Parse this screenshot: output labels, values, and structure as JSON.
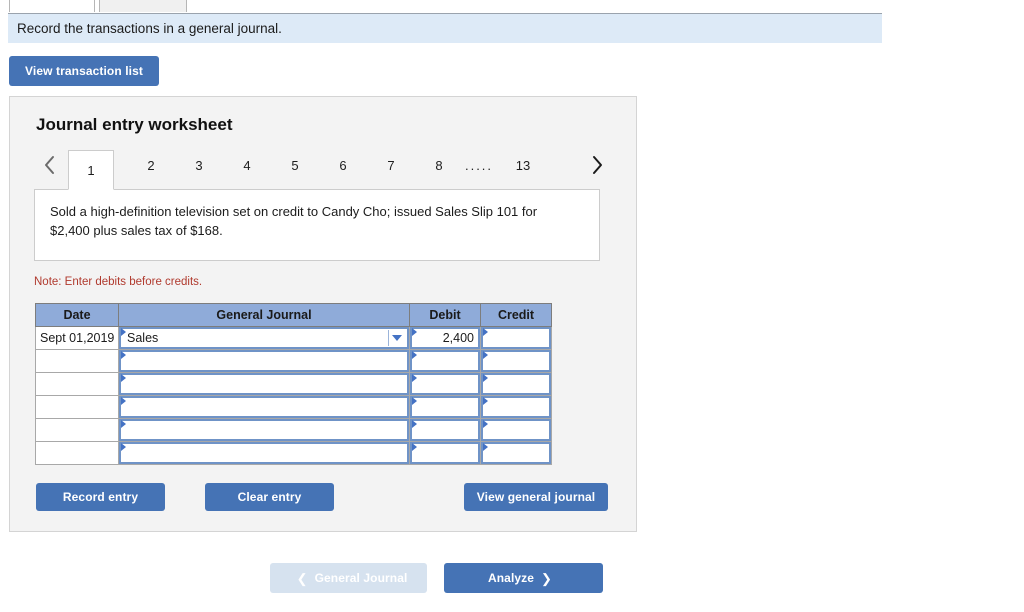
{
  "top_tabs": [
    {
      "name": "tab-one",
      "label": "",
      "active": true
    },
    {
      "name": "tab-two",
      "label": "",
      "active": false
    }
  ],
  "banner": {
    "text": "Record the transactions in a general journal.",
    "background": "#ddeaf7"
  },
  "toolbar": {
    "view_transaction_list_label": "View transaction list"
  },
  "worksheet": {
    "title": "Journal entry worksheet",
    "pager": {
      "prev_icon": "chevron-left-icon",
      "next_icon": "chevron-right-icon",
      "pages": [
        "1",
        "2",
        "3",
        "4",
        "5",
        "6",
        "7",
        "8"
      ],
      "ellipsis": ".....",
      "last_page": "13",
      "active_page": "1"
    },
    "transaction": {
      "description": "Sold a high-definition television set on credit to Candy Cho; issued Sales Slip 101 for $2,400 plus sales tax of $168."
    },
    "note": "Note: Enter debits before credits.",
    "table": {
      "headers": [
        "Date",
        "General Journal",
        "Debit",
        "Credit"
      ],
      "header_color": "#8fabd9",
      "rows": [
        {
          "date": "Sept 01,2019",
          "account": "Sales",
          "debit": "2,400",
          "credit": "",
          "has_dropdown": true
        },
        {
          "date": "",
          "account": "",
          "debit": "",
          "credit": "",
          "has_dropdown": false
        },
        {
          "date": "",
          "account": "",
          "debit": "",
          "credit": "",
          "has_dropdown": false
        },
        {
          "date": "",
          "account": "",
          "debit": "",
          "credit": "",
          "has_dropdown": false
        },
        {
          "date": "",
          "account": "",
          "debit": "",
          "credit": "",
          "has_dropdown": false
        },
        {
          "date": "",
          "account": "",
          "debit": "",
          "credit": "",
          "has_dropdown": false
        }
      ]
    },
    "actions": {
      "record_entry_label": "Record entry",
      "clear_entry_label": "Clear entry",
      "view_general_journal_label": "View general journal"
    }
  },
  "footer": {
    "prev_label": "General Journal",
    "prev_icon": "chevron-left-icon",
    "prev_disabled": true,
    "next_label": "Analyze",
    "next_icon": "chevron-right-icon"
  },
  "colors": {
    "primary_button": "#4573b5",
    "disabled_button": "#d6e2ef",
    "table_header": "#8fabd9",
    "note_red": "#b03a2e",
    "input_border_blue": "#6f93c7"
  }
}
